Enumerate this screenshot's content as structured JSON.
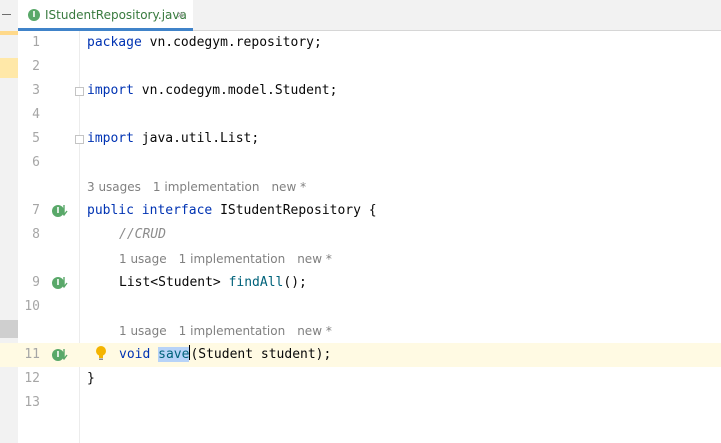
{
  "tab": {
    "label": "IStudentRepository.java",
    "icon": "interface-icon",
    "close": "×"
  },
  "lines": [
    {
      "num": "1",
      "code": "package vn.codegym.repository;"
    },
    {
      "num": "2"
    },
    {
      "num": "3",
      "code": "import vn.codegym.model.Student;"
    },
    {
      "num": "4"
    },
    {
      "num": "5",
      "code": "import java.util.List;"
    },
    {
      "num": "6"
    },
    {
      "num": "7",
      "code": "public interface IStudentRepository {"
    },
    {
      "num": "8",
      "code": "//CRUD"
    },
    {
      "num": "9",
      "code": "List<Student> findAll();"
    },
    {
      "num": "10"
    },
    {
      "num": "11",
      "code": "void save(Student student);"
    },
    {
      "num": "12",
      "code": "}"
    },
    {
      "num": "13"
    }
  ],
  "hints": {
    "interface": {
      "usages": "3 usages",
      "impl": "1 implementation",
      "new": "new *"
    },
    "find_all": {
      "usages": "1 usage",
      "impl": "1 implementation",
      "new": "new *"
    },
    "save": {
      "usages": "1 usage",
      "impl": "1 implementation",
      "new": "new *"
    }
  },
  "tokens": {
    "package_kw": "package",
    "package_name": " vn.codegym.repository;",
    "import_kw": "import",
    "import1": " vn.codegym.model.Student;",
    "import2": " java.util.List;",
    "public_kw": "public",
    "interface_kw": " interface",
    "iface_name": " IStudentRepository {",
    "comment": "//CRUD",
    "list_type": "List<Student> ",
    "find_all": "findAll",
    "find_all_rest": "();",
    "void_kw": "void",
    "save_name": "save",
    "save_rest": "(Student student);",
    "close_brace": "}"
  },
  "colors": {
    "keyword": "#0033b3",
    "comment": "#8c8c8c",
    "method": "#00627a",
    "current_line": "#fffae3",
    "selection": "#b7d3f8",
    "tab_text": "#387a3e",
    "implemented_icon": "#59a869"
  }
}
